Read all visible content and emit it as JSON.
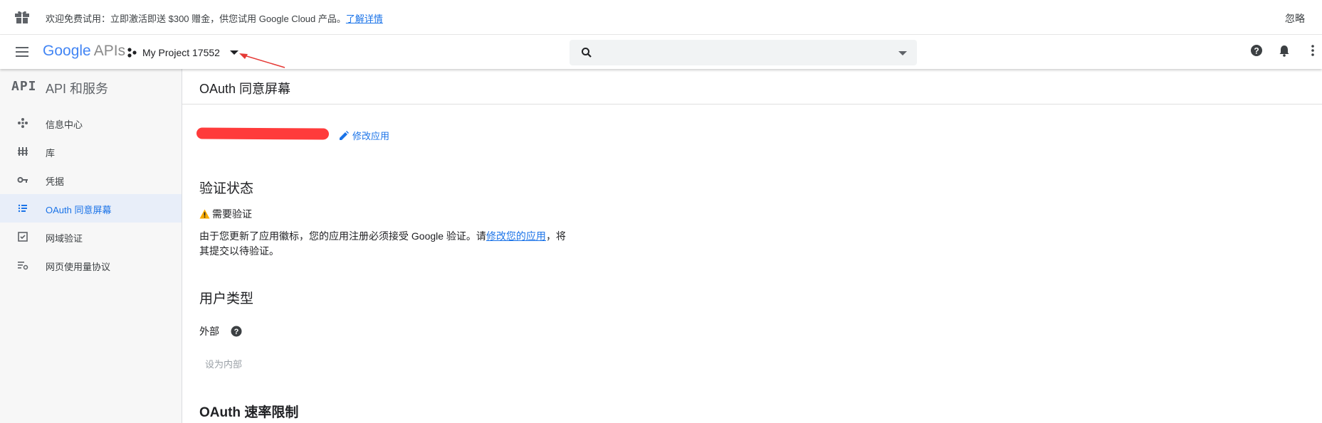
{
  "promo": {
    "text": "欢迎免费试用：立即激活即送 $300 赠金，供您试用 Google Cloud 产品。",
    "link": "了解详情",
    "dismiss": "忽略"
  },
  "appbar": {
    "logo_google": "Google",
    "logo_apis": "APIs",
    "project_name": "My Project 17552",
    "search_value": ""
  },
  "sidebar": {
    "logo": "API",
    "title": "API 和服务",
    "items": [
      {
        "label": "信息中心",
        "icon": "dashboard-icon",
        "active": false
      },
      {
        "label": "库",
        "icon": "library-icon",
        "active": false
      },
      {
        "label": "凭据",
        "icon": "key-icon",
        "active": false
      },
      {
        "label": "OAuth 同意屏幕",
        "icon": "consent-screen-icon",
        "active": true
      },
      {
        "label": "网域验证",
        "icon": "domain-verification-icon",
        "active": false
      },
      {
        "label": "网页使用量协议",
        "icon": "usage-agreement-icon",
        "active": false
      }
    ]
  },
  "main": {
    "page_title": "OAuth 同意屏幕",
    "edit_app": "修改应用",
    "verification_heading": "验证状态",
    "verification_status": "需要验证",
    "verification_text_before": "由于您更新了应用徽标，您的应用注册必须接受 Google 验证。请",
    "verification_link": "修改您的应用",
    "verification_text_after": "，将其提交以待验证。",
    "user_type_heading": "用户类型",
    "user_type_value": "外部",
    "make_internal": "设为内部",
    "rate_limit_heading": "OAuth 速率限制"
  },
  "colors": {
    "accent": "#1a73e8",
    "warning": "#f9ab00",
    "redaction": "#ff3b3b",
    "annotation_arrow": "#e53935"
  }
}
